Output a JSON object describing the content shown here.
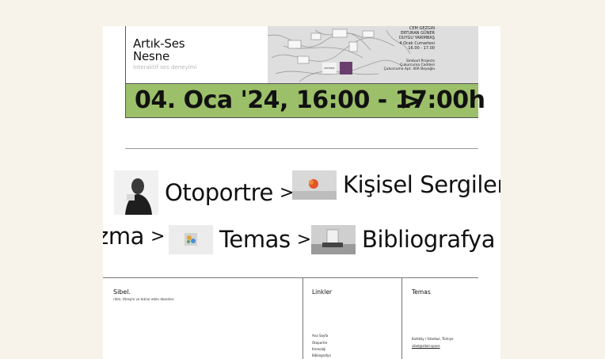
{
  "event": {
    "title_line1": "Artık-Ses",
    "title_line2": "Nesne",
    "subtitle": "İnteraktif ses deneyimi",
    "poster": {
      "names": [
        "CEM GEZGİN",
        "ERTURAN GÜNER",
        "DUYGU YARIMBAŞ"
      ],
      "date": "4 Ocak Cumartesi",
      "time": "16.00 - 17.00",
      "venue_name": "Simbart Projects",
      "venue_line1": "Çukurcuma Caddesi",
      "venue_line2": "Çukurcuma Apt. 40A Beyoğlu",
      "logo_text": "simbart"
    },
    "date_range": "04. Oca '24, 16:00 - 17:00h",
    "accent_color": "#9cbf69"
  },
  "links_row1": [
    {
      "label": "Otoportre",
      "icon": "chevron-right-icon"
    },
    {
      "label": "Kişisel Sergiler",
      "icon": "chevron-right-icon"
    }
  ],
  "links_row2": [
    {
      "label": "zma",
      "icon": "chevron-right-icon"
    },
    {
      "label": "Temas",
      "icon": "chevron-right-icon"
    },
    {
      "label": "Bibliografya",
      "icon": "chevron-right-icon"
    }
  ],
  "footer": {
    "brand": "Sibel.",
    "tagline": "ritim, titreşim ve tekrar eden desenler.",
    "links_title": "Linkler",
    "links": [
      "Ana Sayfa",
      "Otoportre",
      "Kronoloji",
      "Bibliografya"
    ],
    "contact_title": "Temas",
    "location": "Kadıköy / İstanbul, Türkiye",
    "email": "sibel@sibel.space"
  }
}
